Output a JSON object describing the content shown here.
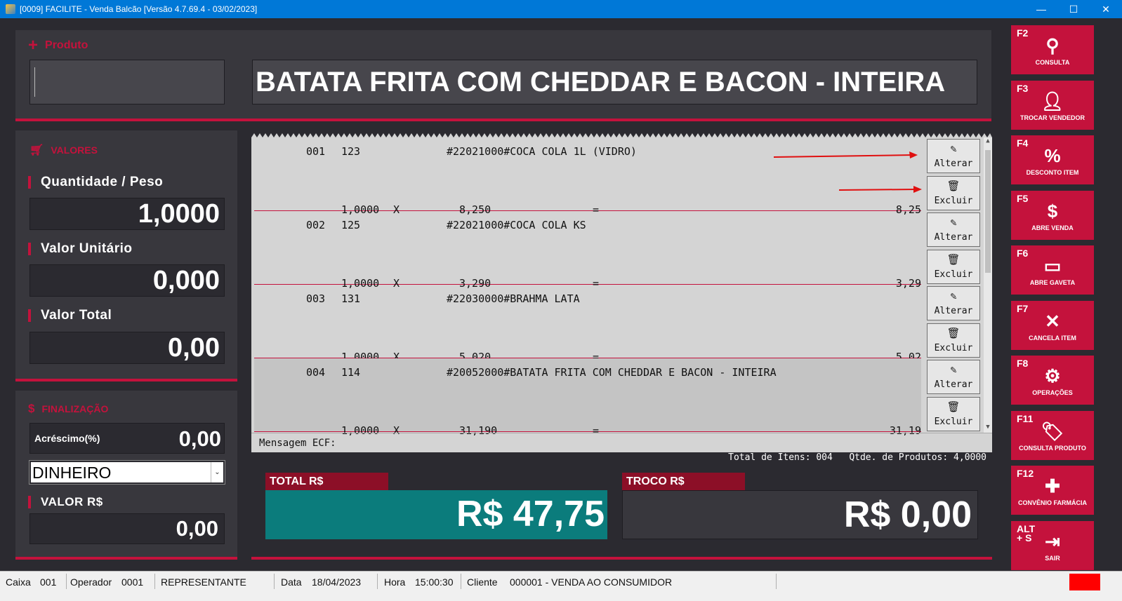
{
  "window": {
    "title": "[0009] FACILITE - Venda Balcão [Versão 4.7.69.4 - 03/02/2023]",
    "minimize": "—",
    "maximize": "☐",
    "close": "✕"
  },
  "produto": {
    "section_label": "Produto",
    "input_value": "",
    "current_product": "BATATA FRITA COM CHEDDAR E BACON - INTEIRA"
  },
  "valores": {
    "section_label": "VALORES",
    "quantidade_label": "Quantidade / Peso",
    "quantidade_value": "1,0000",
    "unitario_label": "Valor Unitário",
    "unitario_value": "0,000",
    "total_label": "Valor Total",
    "total_value": "0,00"
  },
  "finalizacao": {
    "section_label": "FINALIZAÇÃO",
    "acrescimo_label": "Acréscimo(%)",
    "acrescimo_value": "0,00",
    "payment_selected": "DINHEIRO",
    "valor_label": "VALOR R$",
    "valor_value": "0,00"
  },
  "items": [
    {
      "seq": "001",
      "code": "123",
      "desc": "#22021000#COCA COLA 1L (VIDRO)",
      "qty": "1,0000",
      "x": "X",
      "unit": "8,250",
      "eq": "=",
      "total": "8,25"
    },
    {
      "seq": "002",
      "code": "125",
      "desc": "#22021000#COCA COLA KS",
      "qty": "1,0000",
      "x": "X",
      "unit": "3,290",
      "eq": "=",
      "total": "3,29"
    },
    {
      "seq": "003",
      "code": "131",
      "desc": "#22030000#BRAHMA LATA",
      "qty": "1,0000",
      "x": "X",
      "unit": "5,020",
      "eq": "=",
      "total": "5,02"
    },
    {
      "seq": "004",
      "code": "114",
      "desc": "#20052000#BATATA FRITA COM CHEDDAR E BACON - INTEIRA",
      "qty": "1,0000",
      "x": "X",
      "unit": "31,190",
      "eq": "=",
      "total": "31,19"
    }
  ],
  "item_actions": {
    "alterar": "Alterar",
    "excluir": "Excluir"
  },
  "receipt": {
    "mensagem_ecf": "Mensagem ECF:",
    "total_itens": "Total de Itens: 004",
    "qtde_produtos": "Qtde. de Produtos: 4,0000"
  },
  "totals": {
    "total_label": "TOTAL R$",
    "total_value": "R$ 47,75",
    "troco_label": "TROCO R$",
    "troco_value": "R$ 0,00"
  },
  "side_buttons": [
    {
      "key": "F2",
      "label": "CONSULTA",
      "icon": "search-icon"
    },
    {
      "key": "F3",
      "label": "TROCAR VENDEDOR",
      "icon": "user-icon"
    },
    {
      "key": "F4",
      "label": "DESCONTO ITEM",
      "icon": "percent-icon"
    },
    {
      "key": "F5",
      "label": "ABRE VENDA",
      "icon": "dollar-icon"
    },
    {
      "key": "F6",
      "label": "ABRE GAVETA",
      "icon": "drawer-icon"
    },
    {
      "key": "F7",
      "label": "CANCELA ITEM",
      "icon": "close-icon"
    },
    {
      "key": "F8",
      "label": "OPERAÇÕES",
      "icon": "gear-icon"
    },
    {
      "key": "F11",
      "label": "CONSULTA PRODUTO",
      "icon": "tag-icon"
    },
    {
      "key": "F12",
      "label": "CONVÊNIO FARMÁCIA",
      "icon": "pills-icon"
    },
    {
      "key": "ALT\n+ S",
      "label": "SAIR",
      "icon": "exit-icon"
    }
  ],
  "statusbar": {
    "caixa_label": "Caixa",
    "caixa_value": "001",
    "operador_label": "Operador",
    "operador_value": "0001",
    "representante": "REPRESENTANTE",
    "data_label": "Data",
    "data_value": "18/04/2023",
    "hora_label": "Hora",
    "hora_value": "15:00:30",
    "cliente_label": "Cliente",
    "cliente_value": "000001 - VENDA AO CONSUMIDOR"
  },
  "colors": {
    "accent": "#c4123c",
    "background": "#2b2a30",
    "panel": "#38373d",
    "total_bg": "#0b7c7c",
    "title_bar": "#0078d7"
  }
}
